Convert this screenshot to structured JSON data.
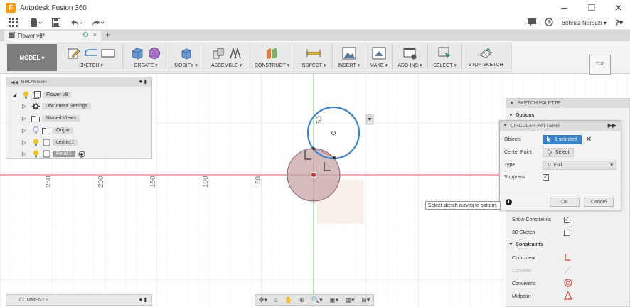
{
  "window": {
    "title": "Autodesk Fusion 360",
    "controls": {
      "minimize": "─",
      "maximize": "☐",
      "close": "✕"
    }
  },
  "quick_access": {
    "user_name": "Behnaz Norouzi ▾",
    "help": "?▾"
  },
  "document_tab": {
    "label": "Flower v8*",
    "close": "×",
    "add": "+"
  },
  "toolbar": {
    "mode": "MODEL ▾",
    "groups": [
      {
        "label": "SKETCH ▾"
      },
      {
        "label": "CREATE ▾"
      },
      {
        "label": "MODIFY ▾"
      },
      {
        "label": "ASSEMBLE ▾"
      },
      {
        "label": "CONSTRUCT ▾"
      },
      {
        "label": "INSPECT ▾"
      },
      {
        "label": "INSERT ▾"
      },
      {
        "label": "MAKE ▾"
      },
      {
        "label": "ADD-INS ▾"
      },
      {
        "label": "SELECT ▾"
      },
      {
        "label": "STOP SKETCH"
      }
    ]
  },
  "browser": {
    "title": "BROWSER",
    "items": [
      {
        "label": "Flower v8"
      },
      {
        "label": "Document Settings"
      },
      {
        "label": "Named Views"
      },
      {
        "label": "Origin"
      },
      {
        "label": "center:1"
      },
      {
        "label": "Petal:1"
      }
    ]
  },
  "comments": {
    "title": "COMMENTS"
  },
  "sketch_palette": {
    "title": "SKETCH PALETTE",
    "options_label": "Options",
    "show_constraints": "Show Constraints",
    "show_constraints_checked": true,
    "sketch_3d": "3D Sketch",
    "sketch_3d_checked": false,
    "constraints_label": "Constraints",
    "constraints": [
      {
        "label": "Coincident",
        "enabled": true
      },
      {
        "label": "Collinear",
        "enabled": false
      },
      {
        "label": "Concentric",
        "enabled": true
      },
      {
        "label": "Midpoint",
        "enabled": true
      }
    ]
  },
  "circular_pattern": {
    "title": "CIRCULAR PATTERN",
    "objects_label": "Objects",
    "objects_value": "1 selected",
    "center_point_label": "Center Point",
    "center_point_value": "Select",
    "type_label": "Type",
    "type_value": "Full",
    "suppress_label": "Suppress",
    "suppress_checked": true,
    "ok": "OK",
    "cancel": "Cancel"
  },
  "tooltip": "Select sketch curves to pattern.",
  "view_cube": {
    "face": "TOP"
  },
  "ruler": {
    "x_ticks": [
      "250",
      "200",
      "150",
      "100",
      "50"
    ],
    "y_tick": "50"
  },
  "colors": {
    "accent_blue": "#3b83c8",
    "axis_red": "#e05a5a",
    "axis_green": "#5ec95e",
    "circle_blue": "#3b83c8",
    "fill_profile": "#c8a4a4"
  }
}
